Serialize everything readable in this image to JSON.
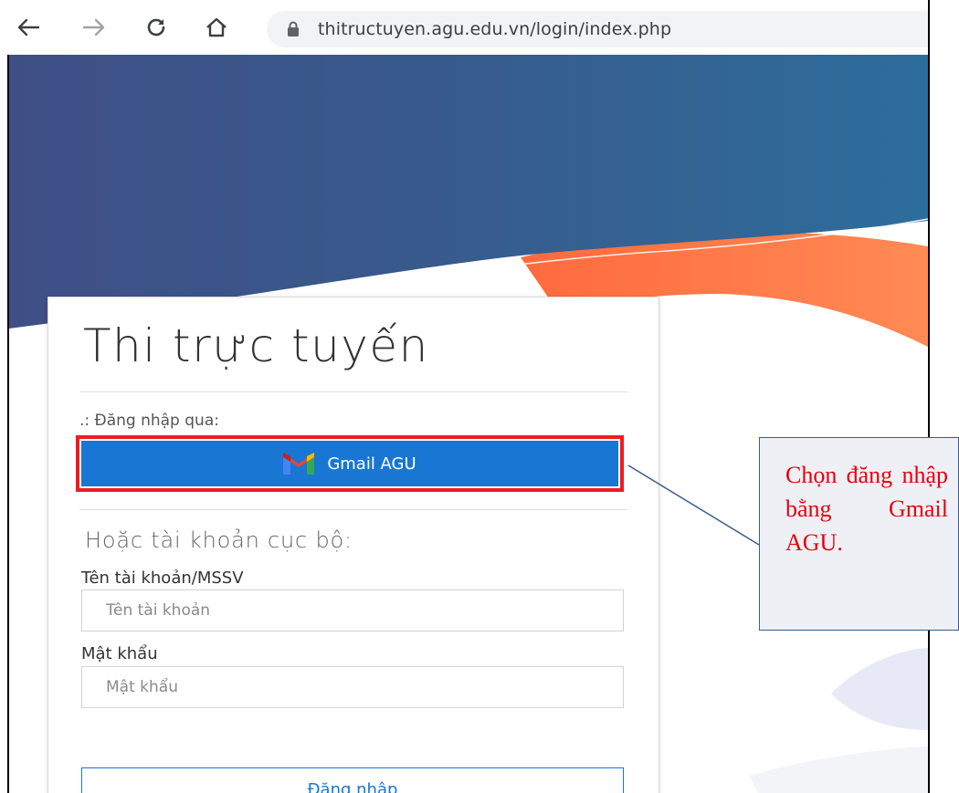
{
  "browser": {
    "url": "thitructuyen.agu.edu.vn/login/index.php",
    "icons": [
      "back-arrow-icon",
      "forward-arrow-icon",
      "reload-icon",
      "home-icon",
      "lock-icon"
    ]
  },
  "login_card": {
    "title": "Thi trực tuyến",
    "login_via_label": ".: Đăng nhập qua:",
    "gmail_button_label": "Gmail AGU",
    "local_account_heading": "Hoặc tài khoản cục bộ:",
    "username_label": "Tên tài khoản/MSSV",
    "username_placeholder": "Tên tài khoản",
    "username_value": "",
    "password_label": "Mật khẩu",
    "password_placeholder": "Mật khẩu",
    "password_value": "",
    "submit_label": "Đăng nhập"
  },
  "callout": {
    "text": "Chọn đăng nhập bằng Gmail AGU."
  },
  "colors": {
    "gmail_button": "#1976d2",
    "highlight_outline": "#ed1c24",
    "callout_text": "#e8000b",
    "hero_dark": "#3f4f86",
    "hero_light": "#2f6f9e",
    "wave_orange": "#ff7a45"
  }
}
